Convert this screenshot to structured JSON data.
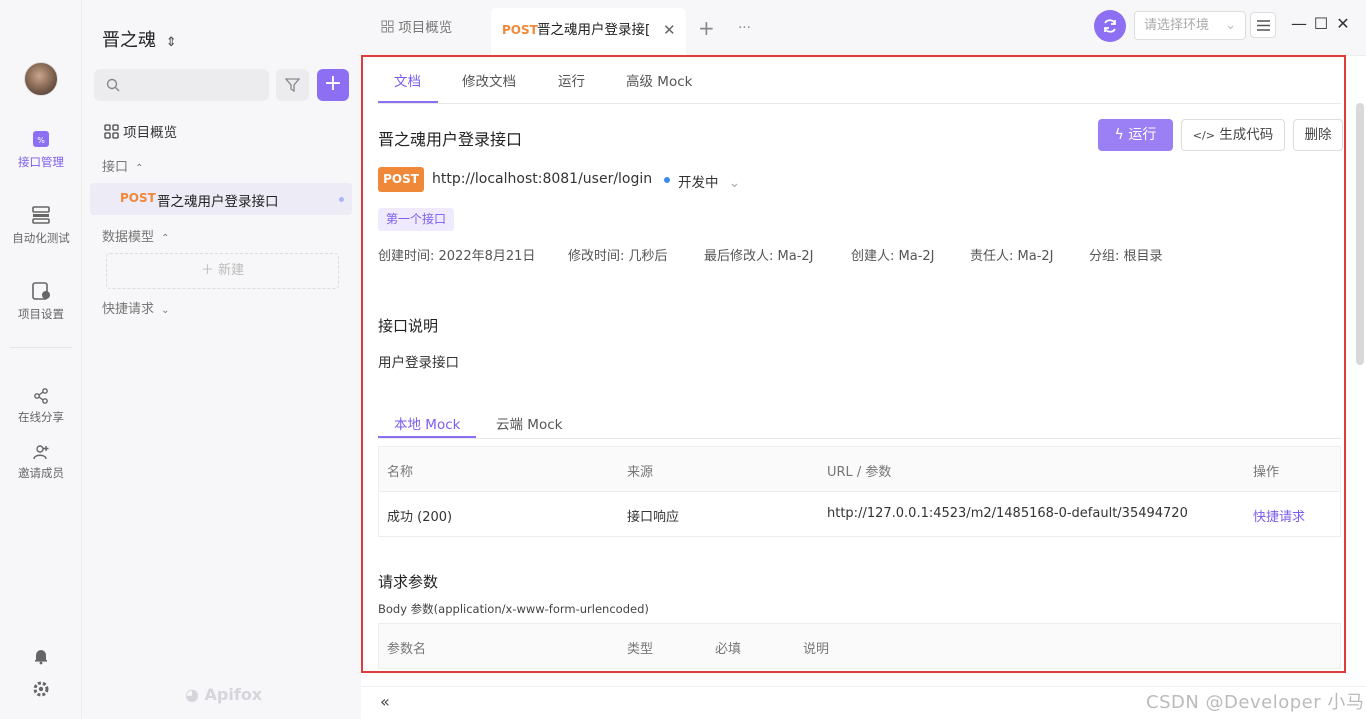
{
  "rail": {
    "items": [
      {
        "label": "接口管理",
        "icon": "api-icon",
        "active": true
      },
      {
        "label": "自动化测试",
        "icon": "automation-icon",
        "active": false
      },
      {
        "label": "项目设置",
        "icon": "project-settings-icon",
        "active": false
      },
      {
        "label": "在线分享",
        "icon": "share-icon",
        "active": false
      },
      {
        "label": "邀请成员",
        "icon": "invite-member-icon",
        "active": false
      }
    ],
    "bottom_icons": [
      "bell-icon",
      "settings-gear-icon"
    ]
  },
  "sidebar": {
    "project_name": "晋之魂",
    "overview_label": "项目概览",
    "api_section": "接口",
    "api_item_method": "POST",
    "api_item_name": "晋之魂用户登录接口",
    "model_section": "数据模型",
    "new_label": "新建",
    "quick_section": "快捷请求",
    "logo_text": "Apifox"
  },
  "tabs": {
    "overview_tab": "项目概览",
    "active_method": "POST",
    "active_name": "晋之魂用户登录接[",
    "env_placeholder": "请选择环境"
  },
  "doc": {
    "tabs": [
      "文档",
      "修改文档",
      "运行",
      "高级 Mock"
    ],
    "title": "晋之魂用户登录接口",
    "run_btn": "运行",
    "gen_btn": "生成代码",
    "del_btn": "删除",
    "method": "POST",
    "url": "http://localhost:8081/user/login",
    "status": "开发中",
    "tag": "第一个接口",
    "meta": [
      "创建时间: 2022年8月21日",
      "修改时间: 几秒后",
      "最后修改人: Ma-2J",
      "创建人: Ma-2J",
      "责任人: Ma-2J",
      "分组: 根目录"
    ],
    "desc_title": "接口说明",
    "desc_body": "用户登录接口",
    "mock_tabs": [
      "本地 Mock",
      "云端 Mock"
    ],
    "mock_headers": [
      "名称",
      "来源",
      "URL / 参数",
      "操作"
    ],
    "mock_row": {
      "name": "成功 (200)",
      "source": "接口响应",
      "url": "http://127.0.0.1:4523/m2/1485168-0-default/35494720",
      "action": "快捷请求"
    },
    "params_title": "请求参数",
    "params_sub": "Body 参数(application/x-www-form-urlencoded)",
    "params_headers": [
      "参数名",
      "类型",
      "必填",
      "说明"
    ]
  },
  "watermark": "CSDN @Developer 小马",
  "colors": {
    "accent": "#8c6ff2",
    "post": "#f0883a",
    "frame": "#e23b3b"
  }
}
